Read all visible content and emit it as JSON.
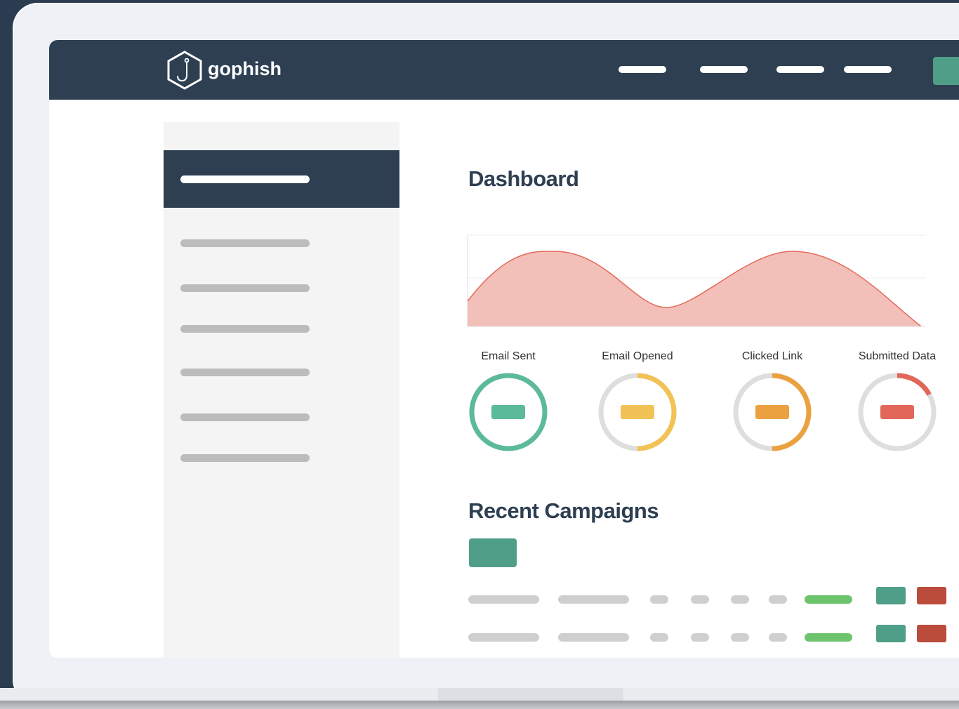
{
  "app": {
    "brand": "gophish",
    "logo_icon": "hook-hexagon-icon"
  },
  "navbar": {
    "links": [
      "",
      "",
      "",
      ""
    ],
    "button_color": "#4f9e88",
    "background": "#2e3f52"
  },
  "sidebar": {
    "active_item": "",
    "items": [
      "",
      "",
      "",
      "",
      "",
      ""
    ]
  },
  "dashboard": {
    "title": "Dashboard",
    "timeline_fill": "#f2c0b9",
    "timeline_stroke": "#e46a5b"
  },
  "stats": [
    {
      "label": "Email Sent",
      "color": "#5bba9a",
      "progress": 1.0
    },
    {
      "label": "Email Opened",
      "color": "#f2c256",
      "progress": 0.5
    },
    {
      "label": "Clicked Link",
      "color": "#eba140",
      "progress": 0.5
    },
    {
      "label": "Submitted Data",
      "color": "#e2675a",
      "progress": 0.17
    }
  ],
  "recent_campaigns": {
    "title": "Recent Campaigns",
    "new_button_color": "#4f9e88",
    "rows": [
      {
        "status_color": "#6cc46c",
        "view_color": "#4f9e88",
        "delete_color": "#bb4b3b"
      },
      {
        "status_color": "#6cc46c",
        "view_color": "#4f9e88",
        "delete_color": "#bb4b3b"
      }
    ]
  }
}
